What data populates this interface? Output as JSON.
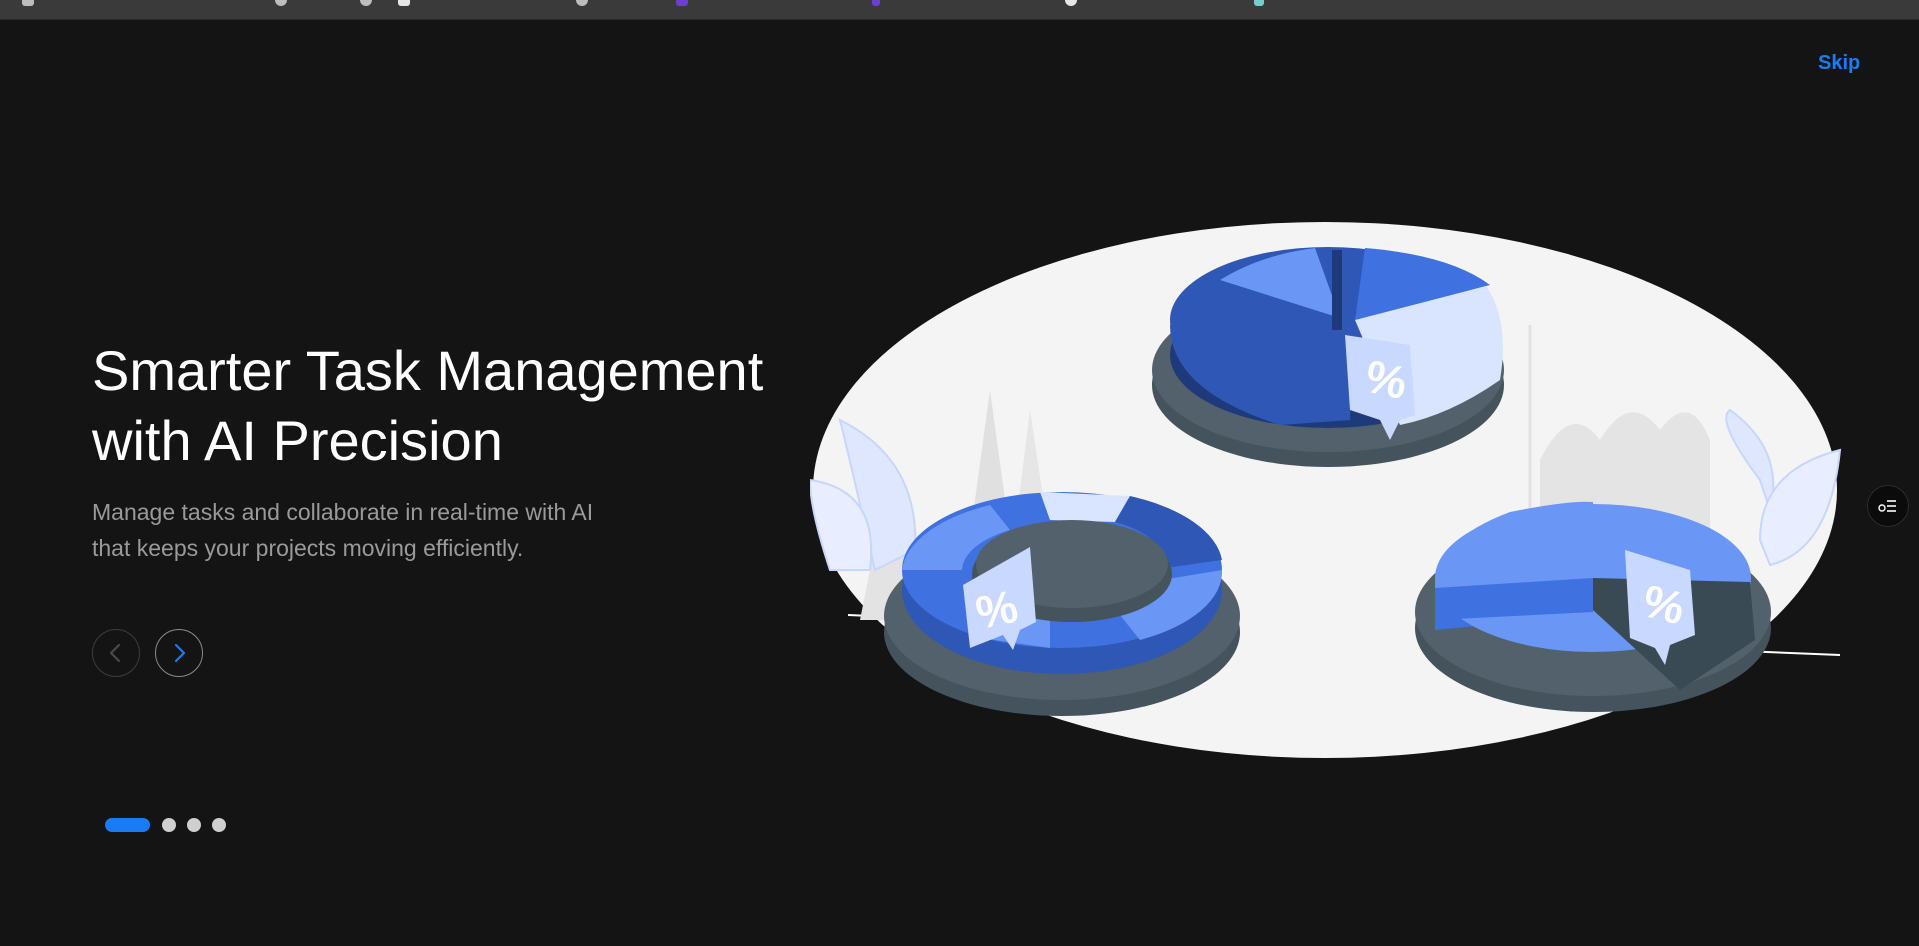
{
  "header": {
    "skip_label": "Skip"
  },
  "hero": {
    "title_line1": "Smarter Task Management",
    "title_line2": "with AI Precision",
    "subtitle_line1": "Manage tasks and collaborate in real-time with AI",
    "subtitle_line2": "that keeps your projects moving efficiently."
  },
  "carousel": {
    "total_slides": 4,
    "active_index": 0,
    "prev_icon": "chevron-left-icon",
    "next_icon": "chevron-right-icon"
  },
  "illustration": {
    "badge_symbol": "%",
    "subject": "3d-pie-charts"
  },
  "colors": {
    "background": "#141414",
    "accent": "#1a7cf5",
    "headline": "#ffffff",
    "subtext": "#9a9a9a",
    "chart_blue_dark": "#2f57b5",
    "chart_blue": "#3f72e0",
    "chart_blue_light": "#6a96f5",
    "chart_blue_pale": "#d9e4ff",
    "chart_base": "#45535c",
    "plate": "#f5f5f5"
  }
}
